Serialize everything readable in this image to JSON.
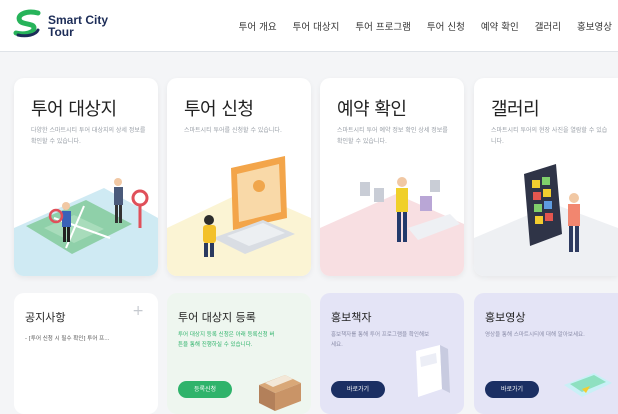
{
  "header": {
    "logo_line1": "Smart City",
    "logo_line2": "Tour",
    "nav": [
      "투어 개요",
      "투어 대상지",
      "투어 프로그램",
      "투어 신청",
      "예약 확인",
      "갤러리",
      "홍보영상"
    ]
  },
  "cards": [
    {
      "title": "투어 대상지",
      "desc": "다양한 스마트시티 투어 대상지의 상세 정보를 확인할 수 있습니다.",
      "floor_color": "#d6eef5",
      "icon": "map-people-illustration"
    },
    {
      "title": "투어 신청",
      "desc": "스마트시티 투어를 신청할 수 있습니다.",
      "floor_color": "#faf5d8",
      "icon": "laptop-person-illustration"
    },
    {
      "title": "예약 확인",
      "desc": "스마트시티 투어 예약 정보 확인 상세 정보를 확인할 수 있습니다.",
      "floor_color": "#f9e3e6",
      "icon": "person-screens-illustration"
    },
    {
      "title": "갤러리",
      "desc": "스마트시티 투어의 현장 사진을 열람할 수 있습니다.",
      "floor_color": "#f1f2f4",
      "icon": "gallery-phone-illustration"
    }
  ],
  "notice": {
    "title": "공지사항",
    "plus": "+",
    "item": "- [투어 신청 시 필수 확인] 투어 프..."
  },
  "register": {
    "title": "투어 대상지 등록",
    "desc": "투어 대상지 등록 신청은 아래 등록신청 버튼을 통해 진행하실 수 있습니다.",
    "button": "등록신청",
    "accent": "#2fb36b"
  },
  "booklet": {
    "title": "홍보책자",
    "desc": "홍보책자를 통해 투어 프로그램을 확인해보세요.",
    "button": "바로가기",
    "accent": "#1b2f63"
  },
  "video": {
    "title": "홍보영상",
    "desc": "영상을 통해 스마트시티에 대해 알아보세요.",
    "button": "바로가기",
    "accent": "#1b2f63"
  }
}
